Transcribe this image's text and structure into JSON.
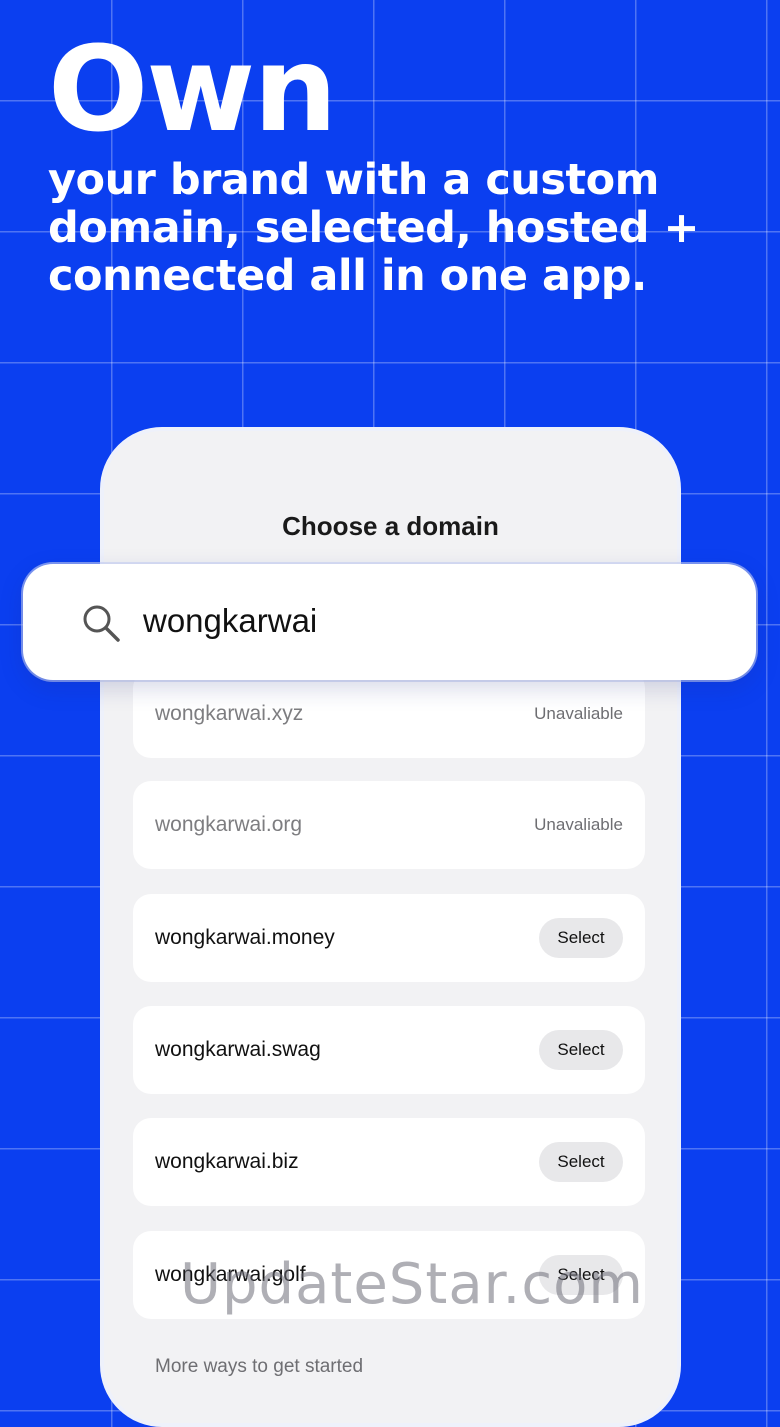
{
  "hero": {
    "headline": "Own",
    "subline": "your brand with a custom domain, selected, hosted + connected all in one app."
  },
  "screen": {
    "title": "Choose a domain",
    "search": {
      "value": "wongkarwai",
      "icon": "search-icon"
    },
    "results": [
      {
        "name": "wongkarwai.xyz",
        "status": "Unavaliable"
      },
      {
        "name": "wongkarwai.org",
        "status": "Unavaliable"
      },
      {
        "name": "wongkarwai.money",
        "action": "Select"
      },
      {
        "name": "wongkarwai.swag",
        "action": "Select"
      },
      {
        "name": "wongkarwai.biz",
        "action": "Select"
      },
      {
        "name": "wongkarwai.golf",
        "action": "Select"
      }
    ],
    "more_label": "More ways to get started"
  },
  "watermark": "UpdateStar.com",
  "colors": {
    "background": "#0b3ff0",
    "card": "#f2f2f4",
    "row": "#ffffff",
    "button": "#e8e8ea"
  }
}
